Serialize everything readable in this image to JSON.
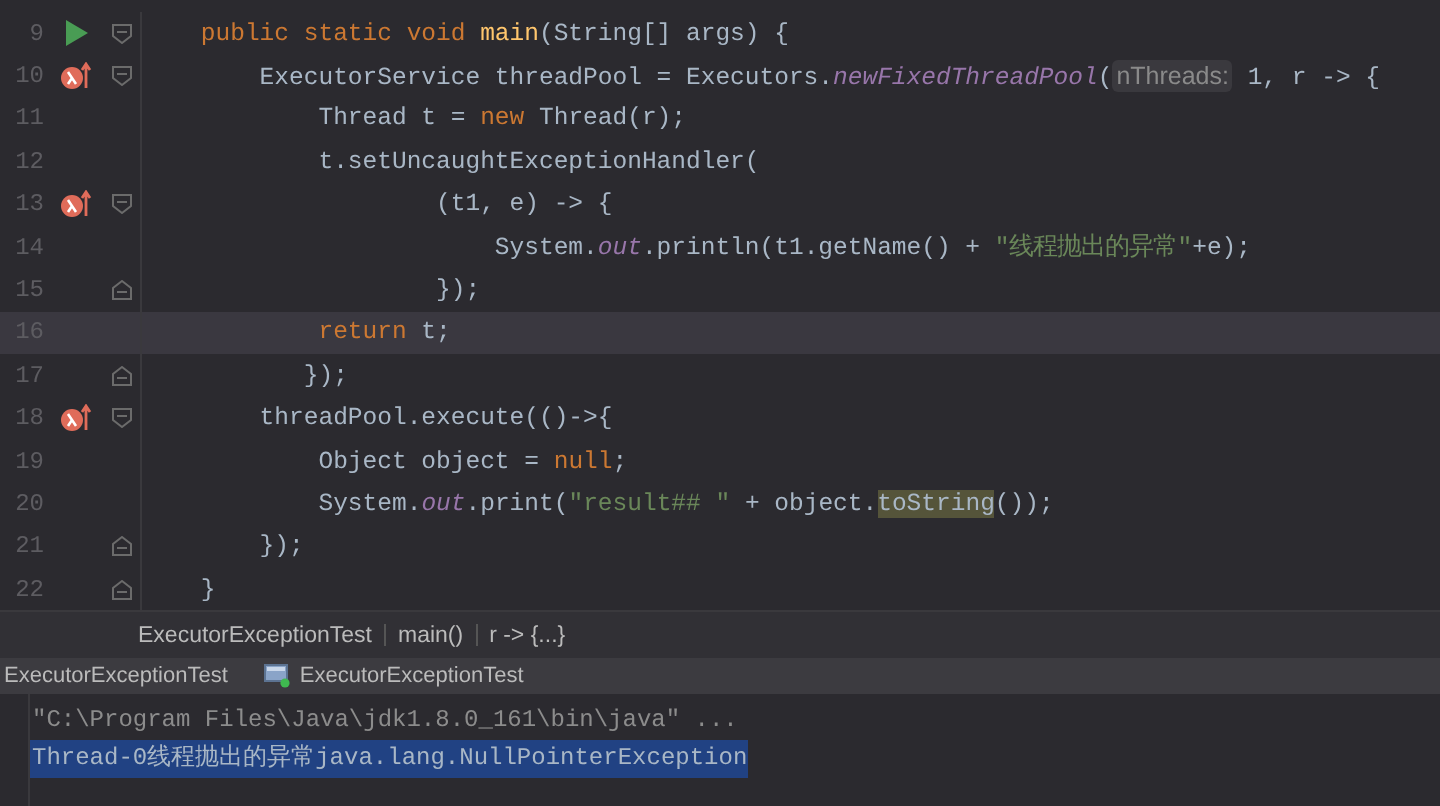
{
  "editor": {
    "lines": [
      {
        "number": "9",
        "runnable": true,
        "lambda_marker": false,
        "fold_start": true,
        "fold_end": false,
        "current": false,
        "tokens": [
          {
            "kind": "kw",
            "text": "    public static void "
          },
          {
            "kind": "method",
            "text": "main"
          },
          {
            "kind": "plain",
            "text": "(String[] args) {"
          }
        ]
      },
      {
        "number": "10",
        "runnable": false,
        "lambda_marker": true,
        "fold_start": true,
        "fold_end": false,
        "current": false,
        "tokens": [
          {
            "kind": "plain",
            "text": "        ExecutorService threadPool = Executors."
          },
          {
            "kind": "static",
            "text": "newFixedThreadPool"
          },
          {
            "kind": "plain",
            "text": "("
          },
          {
            "kind": "hint",
            "text": "nThreads:"
          },
          {
            "kind": "plain",
            "text": " 1, r -> {"
          }
        ]
      },
      {
        "number": "11",
        "runnable": false,
        "lambda_marker": false,
        "fold_start": false,
        "fold_end": false,
        "current": false,
        "tokens": [
          {
            "kind": "plain",
            "text": "            Thread t = "
          },
          {
            "kind": "kw",
            "text": "new"
          },
          {
            "kind": "plain",
            "text": " Thread(r);"
          }
        ]
      },
      {
        "number": "12",
        "runnable": false,
        "lambda_marker": false,
        "fold_start": false,
        "fold_end": false,
        "current": false,
        "tokens": [
          {
            "kind": "plain",
            "text": "            t.setUncaughtExceptionHandler("
          }
        ]
      },
      {
        "number": "13",
        "runnable": false,
        "lambda_marker": true,
        "fold_start": true,
        "fold_end": false,
        "current": false,
        "tokens": [
          {
            "kind": "plain",
            "text": "                    (t1, e) -> {"
          }
        ]
      },
      {
        "number": "14",
        "runnable": false,
        "lambda_marker": false,
        "fold_start": false,
        "fold_end": false,
        "current": false,
        "tokens": [
          {
            "kind": "plain",
            "text": "                        System."
          },
          {
            "kind": "static",
            "text": "out"
          },
          {
            "kind": "plain",
            "text": ".println(t1.getName() + "
          },
          {
            "kind": "str",
            "text": "\"线程抛出的异常\""
          },
          {
            "kind": "plain",
            "text": "+e);"
          }
        ]
      },
      {
        "number": "15",
        "runnable": false,
        "lambda_marker": false,
        "fold_start": false,
        "fold_end": true,
        "current": false,
        "tokens": [
          {
            "kind": "plain",
            "text": "                    });"
          }
        ]
      },
      {
        "number": "16",
        "runnable": false,
        "lambda_marker": false,
        "fold_start": false,
        "fold_end": false,
        "current": true,
        "tokens": [
          {
            "kind": "kw",
            "text": "            return"
          },
          {
            "kind": "plain",
            "text": " t;"
          }
        ]
      },
      {
        "number": "17",
        "runnable": false,
        "lambda_marker": false,
        "fold_start": false,
        "fold_end": true,
        "current": false,
        "tokens": [
          {
            "kind": "plain",
            "text": "           });"
          }
        ]
      },
      {
        "number": "18",
        "runnable": false,
        "lambda_marker": true,
        "fold_start": true,
        "fold_end": false,
        "current": false,
        "tokens": [
          {
            "kind": "plain",
            "text": "        threadPool.execute(()->{"
          }
        ]
      },
      {
        "number": "19",
        "runnable": false,
        "lambda_marker": false,
        "fold_start": false,
        "fold_end": false,
        "current": false,
        "tokens": [
          {
            "kind": "plain",
            "text": "            Object object = "
          },
          {
            "kind": "kw",
            "text": "null"
          },
          {
            "kind": "plain",
            "text": ";"
          }
        ]
      },
      {
        "number": "20",
        "runnable": false,
        "lambda_marker": false,
        "fold_start": false,
        "fold_end": false,
        "current": false,
        "tokens": [
          {
            "kind": "plain",
            "text": "            System."
          },
          {
            "kind": "static",
            "text": "out"
          },
          {
            "kind": "plain",
            "text": ".print("
          },
          {
            "kind": "str",
            "text": "\"result## \""
          },
          {
            "kind": "plain",
            "text": " + object."
          },
          {
            "kind": "match",
            "text": "toString"
          },
          {
            "kind": "plain",
            "text": "());"
          }
        ]
      },
      {
        "number": "21",
        "runnable": false,
        "lambda_marker": false,
        "fold_start": false,
        "fold_end": true,
        "current": false,
        "tokens": [
          {
            "kind": "plain",
            "text": "        });"
          }
        ]
      },
      {
        "number": "22",
        "runnable": false,
        "lambda_marker": false,
        "fold_start": false,
        "fold_end": true,
        "current": false,
        "tokens": [
          {
            "kind": "plain",
            "text": "    }"
          }
        ]
      }
    ]
  },
  "breadcrumbs": [
    "ExecutorExceptionTest",
    "main()",
    "r -> {...}"
  ],
  "run_panel": {
    "title": "ExecutorExceptionTest",
    "tab": "ExecutorExceptionTest",
    "console": [
      {
        "text": "\"C:\\Program Files\\Java\\jdk1.8.0_161\\bin\\java\" ...",
        "selected": false
      },
      {
        "text": "Thread-0线程抛出的异常java.lang.NullPointerException",
        "selected": true
      }
    ]
  }
}
